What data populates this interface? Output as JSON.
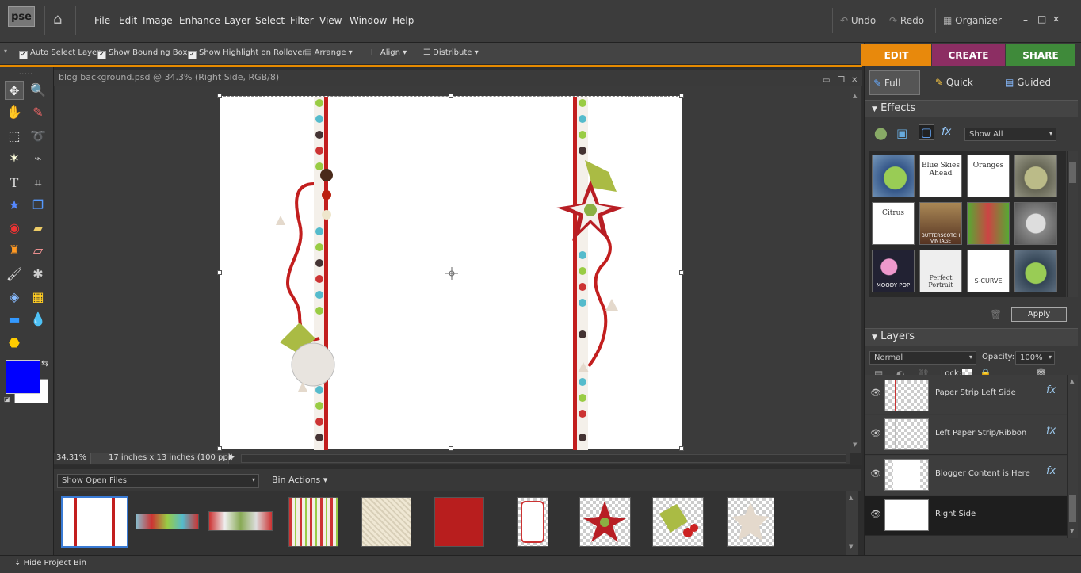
{
  "app": {
    "logo": "pse",
    "title": "blog background.psd @ 34.3% (Right Side, RGB/8)"
  },
  "menu": [
    "File",
    "Edit",
    "Image",
    "Enhance",
    "Layer",
    "Select",
    "Filter",
    "View",
    "Window",
    "Help"
  ],
  "history": {
    "undo": "Undo",
    "redo": "Redo",
    "organizer": "Organizer"
  },
  "window_controls": {
    "minimize": "–",
    "maximize": "□",
    "close": "✕"
  },
  "options": {
    "auto_select": "Auto Select Layer",
    "bounding_box": "Show Bounding Box",
    "highlight": "Show Highlight on Rollover",
    "arrange": "Arrange",
    "align": "Align",
    "distribute": "Distribute"
  },
  "tabs": {
    "edit": "EDIT",
    "create": "CREATE",
    "share": "SHARE"
  },
  "modes": {
    "full": "Full",
    "quick": "Quick",
    "guided": "Guided"
  },
  "effects": {
    "title": "Effects",
    "filter": "Show All",
    "apply": "Apply",
    "items": [
      "",
      "Blue Skies Ahead",
      "Oranges",
      "",
      "Citrus",
      "BUTTERSCOTCH VINTAGE",
      "",
      "",
      "MOODY POP",
      "Perfect Portrait",
      "S-CURVE",
      ""
    ]
  },
  "layers": {
    "title": "Layers",
    "blend_mode": "Normal",
    "opacity_label": "Opacity:",
    "opacity_value": "100%",
    "lock_label": "Lock:",
    "items": [
      {
        "name": "Paper Strip Left Side",
        "fx": "fx"
      },
      {
        "name": "Left Paper Strip/Ribbon",
        "fx": "fx"
      },
      {
        "name": "Blogger Content is Here",
        "fx": "fx"
      },
      {
        "name": "Right Side",
        "fx": ""
      }
    ]
  },
  "status": {
    "zoom": "34.31%",
    "doc_size": "17 inches x 13 inches (100 ppi)"
  },
  "bin": {
    "show_label": "Show Open Files",
    "actions_label": "Bin Actions",
    "hide_label": "Hide Project Bin"
  },
  "colors": {
    "foreground": "#0000ff",
    "background": "#ffffff",
    "edit_tab": "#e8890c",
    "create_tab": "#8c2e63",
    "share_tab": "#3f8a3a"
  }
}
